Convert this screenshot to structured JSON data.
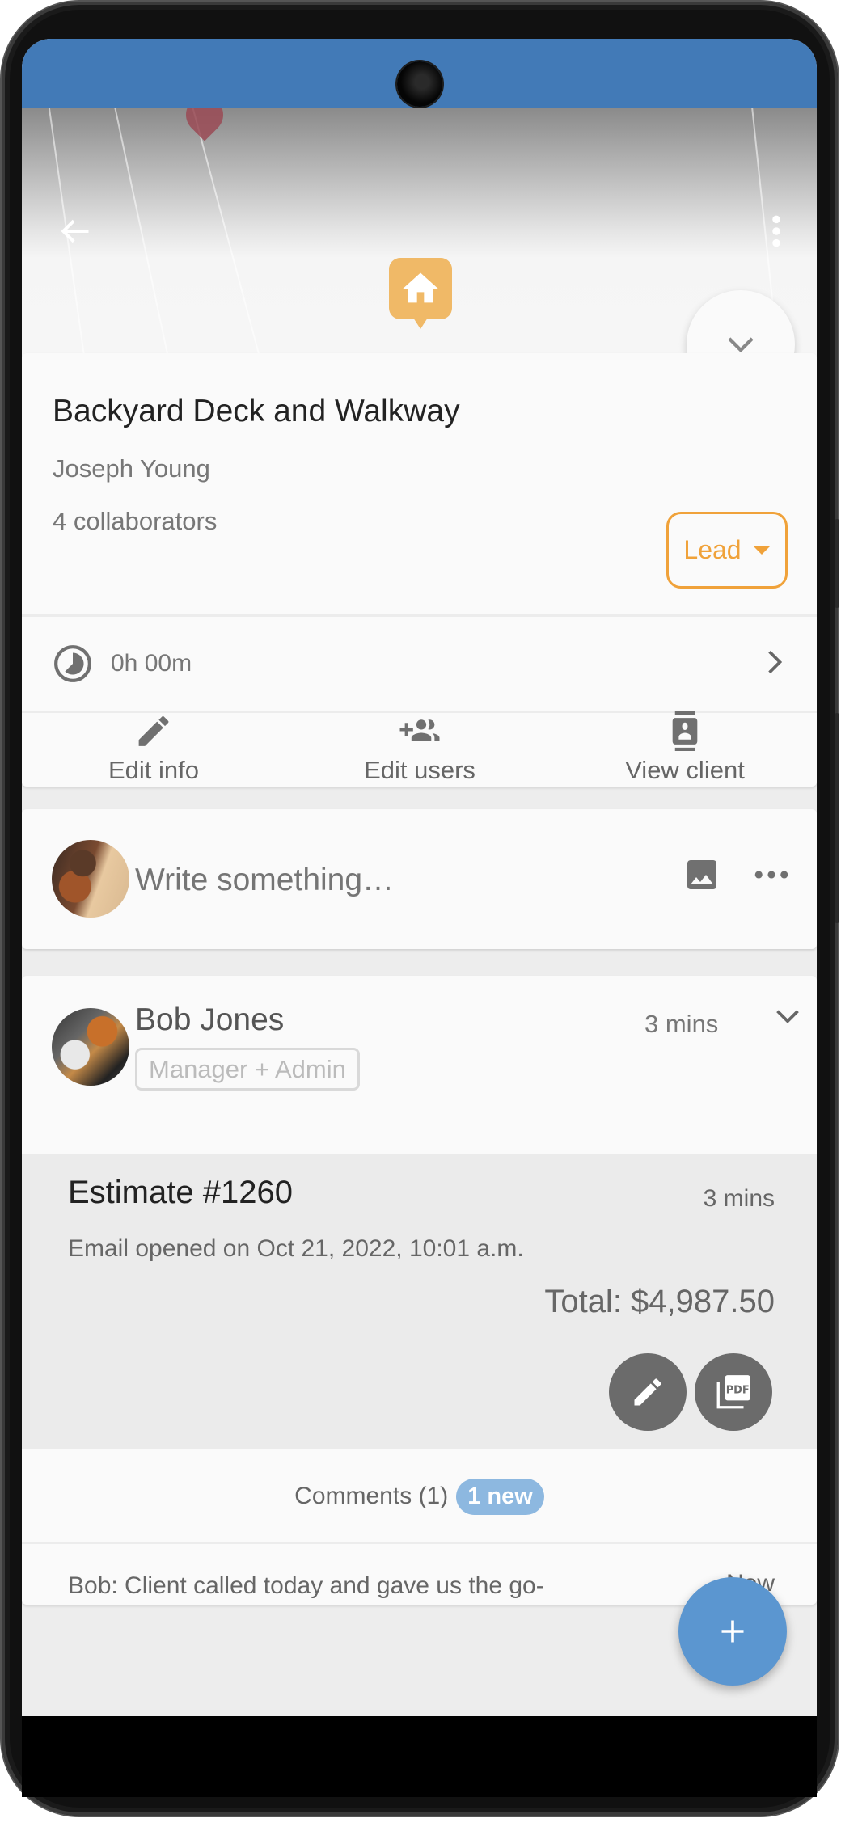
{
  "colors": {
    "status_bar": "#427ab7",
    "accent_orange": "#f0a23a",
    "marker_orange": "#f0b967",
    "fab_blue": "#5b96d0",
    "badge_blue": "#8db8e0"
  },
  "header": {
    "back_icon": "arrow-left-icon",
    "menu_icon": "more-vertical-icon",
    "collapse_icon": "chevron-down-icon",
    "map_marker_icon": "home-icon",
    "poi_icon": "hotel-bed-icon"
  },
  "project": {
    "title": "Backyard Deck and Walkway",
    "client": "Joseph Young",
    "collaborators": "4 collaborators",
    "status": "Lead",
    "time_tracked": "0h 00m",
    "actions": [
      {
        "label": "Edit info",
        "icon": "pencil-icon"
      },
      {
        "label": "Edit users",
        "icon": "add-group-icon"
      },
      {
        "label": "View client",
        "icon": "contact-card-icon"
      }
    ]
  },
  "composer": {
    "placeholder": "Write something…",
    "image_icon": "image-icon",
    "more_icon": "more-horizontal-icon"
  },
  "post": {
    "author": "Bob Jones",
    "role": "Manager + Admin",
    "time": "3 mins",
    "estimate": {
      "title": "Estimate #1260",
      "time": "3 mins",
      "status_line": "Email opened on Oct 21, 2022, 10:01 a.m.",
      "total": "Total: $4,987.50",
      "edit_icon": "pencil-icon",
      "pdf_icon": "pdf-icon",
      "pdf_text": "PDF"
    },
    "comments_label": "Comments (1)",
    "new_badge": "1 new",
    "latest_comment": {
      "text": "Bob: Client called today and gave us the go-ahead. We can start work on Monday",
      "time": "Now"
    }
  },
  "fab": {
    "icon": "plus-icon"
  }
}
